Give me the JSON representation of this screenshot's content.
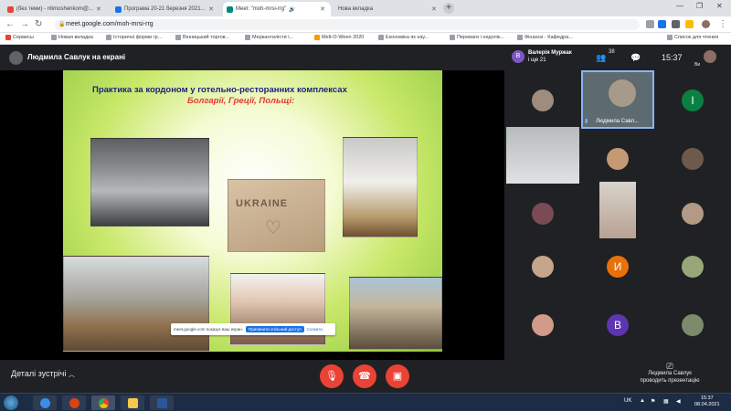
{
  "browser": {
    "tabs": [
      {
        "label": "(без теми) - ntimoshenkom@..."
      },
      {
        "label": "Програма 20-21 березня 2021..."
      },
      {
        "label": "Meet: \"moh-mrsi-rrg\""
      },
      {
        "label": "Нова вкладка"
      }
    ],
    "url": "meet.google.com/moh-mrsi-rrg",
    "bookmarks": [
      "Сервисы",
      "Новая вкладка",
      "Історичні форми гр...",
      "Вінницький торгов...",
      "Меркантилісти і...",
      "Melt-O-Ween 2020",
      "Економіка як нау...",
      "Переваги і недолік...",
      "Фінанси - Кафедра...",
      "Список для чтения"
    ]
  },
  "meet": {
    "presenter_label": "Людмила Савлук на екрані",
    "joined_name": "Валерія Муржак",
    "joined_more": "і ще 21",
    "participant_count": "38",
    "time": "15:37",
    "self_label": "Ви",
    "active_speaker_name": "Людмила Савл...",
    "letter_tiles": [
      "І",
      "И",
      "В"
    ]
  },
  "slide": {
    "title_line1": "Практика за кордоном у готельно-ресторанних комплексах",
    "title_line2": "Болгарії, Греції, Польщі:",
    "sand_text": "UKRAINE",
    "share_notice": "meet.google.com показує ваш екран.",
    "share_stop": "Припинити спільний доступ",
    "share_hide": "Сховати"
  },
  "controls": {
    "details_label": "Деталі зустрічі",
    "present_line1": "Людмила Савлук",
    "present_line2": "проводить презентацію"
  },
  "taskbar": {
    "lang": "UK",
    "time": "15:37",
    "date": "08.04.2021"
  },
  "colors": {
    "meet_red": "#ea4335",
    "meet_bg": "#202124",
    "slide_green": "#8cc63f",
    "avatar_orange": "#e8710a",
    "avatar_purple": "#5e35b1",
    "avatar_green": "#0b8043"
  }
}
